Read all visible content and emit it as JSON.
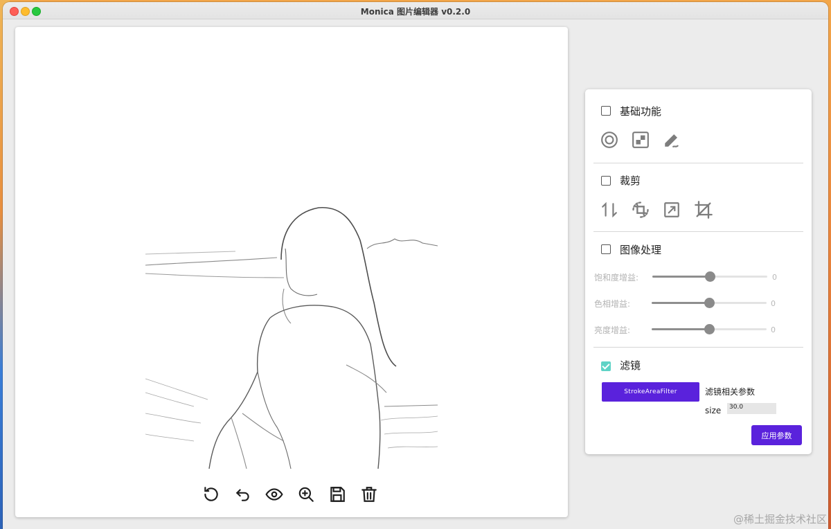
{
  "window": {
    "title": "Monica 图片编辑器 v0.2.0"
  },
  "toolbar": {
    "icons": [
      "rotate-ccw-icon",
      "undo-icon",
      "eye-icon",
      "zoom-in-icon",
      "save-icon",
      "delete-icon"
    ]
  },
  "panel": {
    "basic": {
      "label": "基础功能",
      "checked": false,
      "icons": [
        "color-picker-icon",
        "mosaic-icon",
        "doodle-icon"
      ]
    },
    "crop": {
      "label": "裁剪",
      "checked": false,
      "icons": [
        "flip-icon",
        "rotate-icon",
        "resize-icon",
        "crop-icon"
      ]
    },
    "image_processing": {
      "label": "图像处理",
      "checked": false,
      "sliders": [
        {
          "label": "饱和度增益:",
          "value": "0",
          "level": 0.5
        },
        {
          "label": "色相增益:",
          "value": "0",
          "level": 0.5
        },
        {
          "label": "亮度增益:",
          "value": "0",
          "level": 0.5
        }
      ]
    },
    "filter": {
      "label": "滤镜",
      "checked": true,
      "button_label": "StrokeAreaFilter",
      "params_title": "滤镜相关参数",
      "param_label": "size",
      "param_value": "30.0",
      "apply_label": "应用参数"
    }
  },
  "colors": {
    "accent": "#5a22dc",
    "checkbox_checked": "#5fd3c6",
    "slider": "#8a8a8a"
  },
  "watermark": "@稀土掘金技术社区"
}
